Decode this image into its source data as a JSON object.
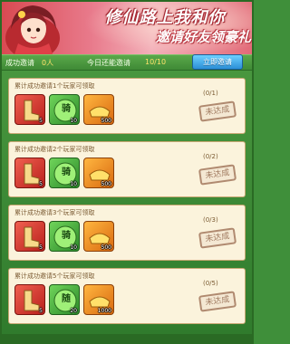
{
  "banner": {
    "line1": "修仙路上我和你",
    "line2": "邀请好友领豪礼"
  },
  "status": {
    "success_label": "成功邀请",
    "success_value": "0人",
    "today_label": "今日还能邀请",
    "today_value": "10/10",
    "invite_button": "立即邀请"
  },
  "cards": [
    {
      "title": "累计成功邀请1个玩家可领取",
      "progress": "(0/1)",
      "status": "未达成",
      "items": [
        {
          "icon": "boots-icon",
          "count": "5"
        },
        {
          "icon": "mount-orb-icon",
          "label": "骑",
          "count": "10"
        },
        {
          "icon": "gold-ingot-icon",
          "count": "500"
        }
      ]
    },
    {
      "title": "累计成功邀请2个玩家可领取",
      "progress": "(0/2)",
      "status": "未达成",
      "items": [
        {
          "icon": "boots-icon",
          "count": "5"
        },
        {
          "icon": "mount-orb-icon",
          "label": "骑",
          "count": "10"
        },
        {
          "icon": "gold-ingot-icon",
          "count": "500"
        }
      ]
    },
    {
      "title": "累计成功邀请3个玩家可领取",
      "progress": "(0/3)",
      "status": "未达成",
      "items": [
        {
          "icon": "boots-icon",
          "count": "5"
        },
        {
          "icon": "mount-orb-icon",
          "label": "骑",
          "count": "10"
        },
        {
          "icon": "gold-ingot-icon",
          "count": "500"
        }
      ]
    },
    {
      "title": "累计成功邀请5个玩家可领取",
      "progress": "(0/5)",
      "status": "未达成",
      "items": [
        {
          "icon": "boots-icon",
          "count": "5"
        },
        {
          "icon": "mount-orb-icon",
          "label": "随",
          "count": "20"
        },
        {
          "icon": "gold-ingot-icon",
          "count": "1000"
        }
      ]
    }
  ]
}
